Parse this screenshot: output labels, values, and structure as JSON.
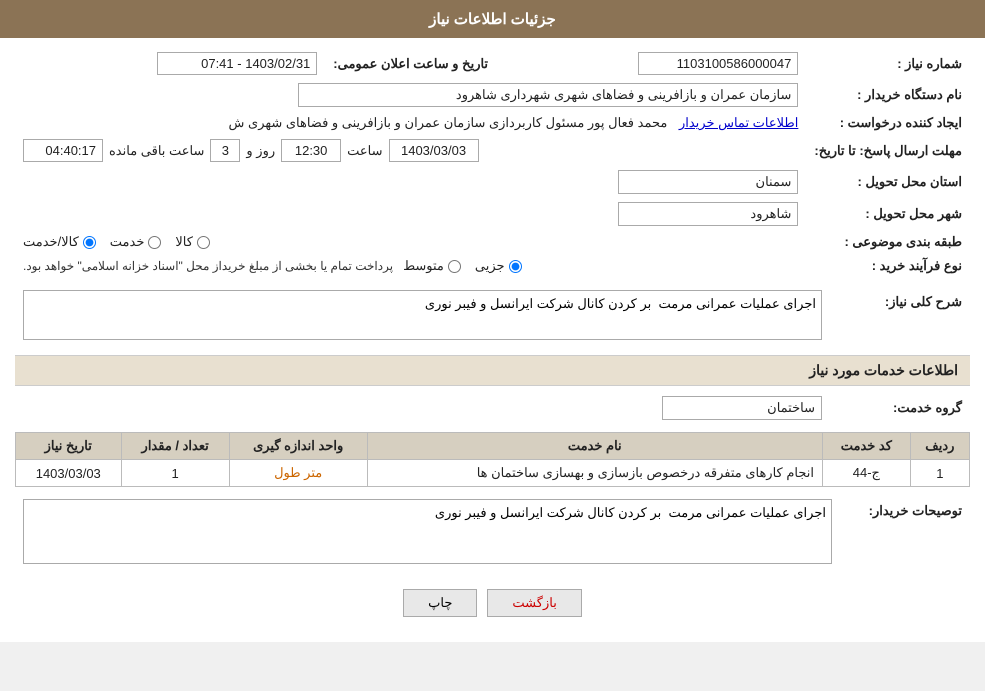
{
  "header": {
    "title": "جزئیات اطلاعات نیاز"
  },
  "fields": {
    "shomareNiaz_label": "شماره نیاز :",
    "shomareNiaz_value": "1103100586000047",
    "namDastgah_label": "نام دستگاه خریدار :",
    "namDastgah_value": "سازمان عمران و بازافرینی و فضاهای شهری شهرداری شاهرود",
    "ijadKonande_label": "ایجاد کننده درخواست :",
    "ijadKonande_value": "محمد فعال پور مسئول کاربردازی سازمان عمران و بازافرینی و فضاهای شهری ش",
    "ijadKonande_link": "اطلاعات تماس خریدار",
    "mohlat_label": "مهلت ارسال پاسخ: تا تاریخ:",
    "mohlat_date": "1403/03/03",
    "mohlat_saat_label": "ساعت",
    "mohlat_saat_value": "12:30",
    "mohlat_roz_label": "روز و",
    "mohlat_roz_value": "3",
    "mohlat_maande_value": "04:40:17",
    "mohlat_maande_label": "ساعت باقی مانده",
    "tarikhoSaat_label": "تاریخ و ساعت اعلان عمومی:",
    "tarikhoSaat_value": "1403/02/31 - 07:41",
    "ostan_label": "استان محل تحویل :",
    "ostan_value": "سمنان",
    "shahr_label": "شهر محل تحویل :",
    "shahr_value": "شاهرود",
    "tabaghe_label": "طبقه بندی موضوعی :",
    "tabaghe_options": [
      {
        "label": "کالا",
        "value": "kala"
      },
      {
        "label": "خدمت",
        "value": "khedmat"
      },
      {
        "label": "کالا/خدمت",
        "value": "kala_khedmat"
      }
    ],
    "tabaghe_selected": "kala_khedmat",
    "noeFarayand_label": "نوع فرآیند خرید :",
    "noeFarayand_options": [
      {
        "label": "جزیی",
        "value": "jozi"
      },
      {
        "label": "متوسط",
        "value": "motevaset"
      }
    ],
    "noeFarayand_selected": "jozi",
    "noeFarayand_note": "پرداخت تمام یا بخشی از مبلغ خریداز محل \"اسناد خزانه اسلامی\" خواهد بود.",
    "sharhKoli_label": "شرح کلی نیاز:",
    "sharhKoli_value": "اجرای عملیات عمرانی مرمت  بر کردن کانال شرکت ایرانسل و فیبر نوری",
    "khadamat_label": "اطلاعات خدمات مورد نیاز",
    "groheKhedmat_label": "گروه خدمت:",
    "groheKhedmat_value": "ساختمان",
    "table": {
      "headers": [
        "ردیف",
        "کد خدمت",
        "نام خدمت",
        "واحد اندازه گیری",
        "تعداد / مقدار",
        "تاریخ نیاز"
      ],
      "rows": [
        {
          "radif": "1",
          "kod": "ج-44",
          "nam": "انجام کارهای متفرقه درخصوص بازسازی و بهسازی ساختمان ها",
          "vahed": "متر طول",
          "tedad": "1",
          "tarikh": "1403/03/03"
        }
      ]
    },
    "tosihKharidar_label": "توصیحات خریدار:",
    "tosihKharidar_value": "اجرای عملیات عمرانی مرمت  بر کردن کانال شرکت ایرانسل و فیبر نوری",
    "btn_print": "چاپ",
    "btn_back": "بازگشت"
  }
}
